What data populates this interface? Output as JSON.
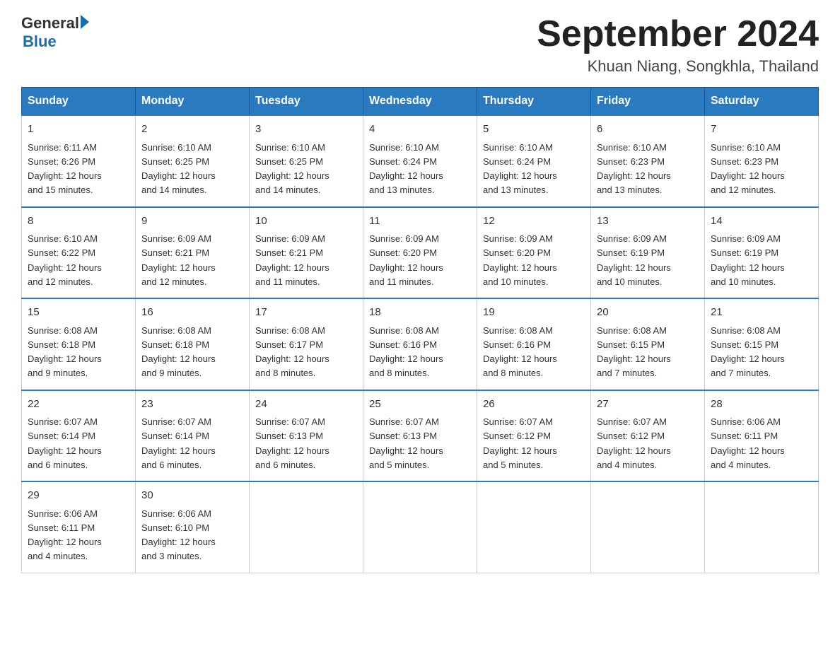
{
  "header": {
    "logo_general": "General",
    "logo_blue": "Blue",
    "title": "September 2024",
    "location": "Khuan Niang, Songkhla, Thailand"
  },
  "weekdays": [
    "Sunday",
    "Monday",
    "Tuesday",
    "Wednesday",
    "Thursday",
    "Friday",
    "Saturday"
  ],
  "weeks": [
    [
      {
        "day": "1",
        "sunrise": "6:11 AM",
        "sunset": "6:26 PM",
        "daylight": "12 hours and 15 minutes."
      },
      {
        "day": "2",
        "sunrise": "6:10 AM",
        "sunset": "6:25 PM",
        "daylight": "12 hours and 14 minutes."
      },
      {
        "day": "3",
        "sunrise": "6:10 AM",
        "sunset": "6:25 PM",
        "daylight": "12 hours and 14 minutes."
      },
      {
        "day": "4",
        "sunrise": "6:10 AM",
        "sunset": "6:24 PM",
        "daylight": "12 hours and 13 minutes."
      },
      {
        "day": "5",
        "sunrise": "6:10 AM",
        "sunset": "6:24 PM",
        "daylight": "12 hours and 13 minutes."
      },
      {
        "day": "6",
        "sunrise": "6:10 AM",
        "sunset": "6:23 PM",
        "daylight": "12 hours and 13 minutes."
      },
      {
        "day": "7",
        "sunrise": "6:10 AM",
        "sunset": "6:23 PM",
        "daylight": "12 hours and 12 minutes."
      }
    ],
    [
      {
        "day": "8",
        "sunrise": "6:10 AM",
        "sunset": "6:22 PM",
        "daylight": "12 hours and 12 minutes."
      },
      {
        "day": "9",
        "sunrise": "6:09 AM",
        "sunset": "6:21 PM",
        "daylight": "12 hours and 12 minutes."
      },
      {
        "day": "10",
        "sunrise": "6:09 AM",
        "sunset": "6:21 PM",
        "daylight": "12 hours and 11 minutes."
      },
      {
        "day": "11",
        "sunrise": "6:09 AM",
        "sunset": "6:20 PM",
        "daylight": "12 hours and 11 minutes."
      },
      {
        "day": "12",
        "sunrise": "6:09 AM",
        "sunset": "6:20 PM",
        "daylight": "12 hours and 10 minutes."
      },
      {
        "day": "13",
        "sunrise": "6:09 AM",
        "sunset": "6:19 PM",
        "daylight": "12 hours and 10 minutes."
      },
      {
        "day": "14",
        "sunrise": "6:09 AM",
        "sunset": "6:19 PM",
        "daylight": "12 hours and 10 minutes."
      }
    ],
    [
      {
        "day": "15",
        "sunrise": "6:08 AM",
        "sunset": "6:18 PM",
        "daylight": "12 hours and 9 minutes."
      },
      {
        "day": "16",
        "sunrise": "6:08 AM",
        "sunset": "6:18 PM",
        "daylight": "12 hours and 9 minutes."
      },
      {
        "day": "17",
        "sunrise": "6:08 AM",
        "sunset": "6:17 PM",
        "daylight": "12 hours and 8 minutes."
      },
      {
        "day": "18",
        "sunrise": "6:08 AM",
        "sunset": "6:16 PM",
        "daylight": "12 hours and 8 minutes."
      },
      {
        "day": "19",
        "sunrise": "6:08 AM",
        "sunset": "6:16 PM",
        "daylight": "12 hours and 8 minutes."
      },
      {
        "day": "20",
        "sunrise": "6:08 AM",
        "sunset": "6:15 PM",
        "daylight": "12 hours and 7 minutes."
      },
      {
        "day": "21",
        "sunrise": "6:08 AM",
        "sunset": "6:15 PM",
        "daylight": "12 hours and 7 minutes."
      }
    ],
    [
      {
        "day": "22",
        "sunrise": "6:07 AM",
        "sunset": "6:14 PM",
        "daylight": "12 hours and 6 minutes."
      },
      {
        "day": "23",
        "sunrise": "6:07 AM",
        "sunset": "6:14 PM",
        "daylight": "12 hours and 6 minutes."
      },
      {
        "day": "24",
        "sunrise": "6:07 AM",
        "sunset": "6:13 PM",
        "daylight": "12 hours and 6 minutes."
      },
      {
        "day": "25",
        "sunrise": "6:07 AM",
        "sunset": "6:13 PM",
        "daylight": "12 hours and 5 minutes."
      },
      {
        "day": "26",
        "sunrise": "6:07 AM",
        "sunset": "6:12 PM",
        "daylight": "12 hours and 5 minutes."
      },
      {
        "day": "27",
        "sunrise": "6:07 AM",
        "sunset": "6:12 PM",
        "daylight": "12 hours and 4 minutes."
      },
      {
        "day": "28",
        "sunrise": "6:06 AM",
        "sunset": "6:11 PM",
        "daylight": "12 hours and 4 minutes."
      }
    ],
    [
      {
        "day": "29",
        "sunrise": "6:06 AM",
        "sunset": "6:11 PM",
        "daylight": "12 hours and 4 minutes."
      },
      {
        "day": "30",
        "sunrise": "6:06 AM",
        "sunset": "6:10 PM",
        "daylight": "12 hours and 3 minutes."
      },
      null,
      null,
      null,
      null,
      null
    ]
  ],
  "labels": {
    "sunrise": "Sunrise:",
    "sunset": "Sunset:",
    "daylight": "Daylight:"
  }
}
